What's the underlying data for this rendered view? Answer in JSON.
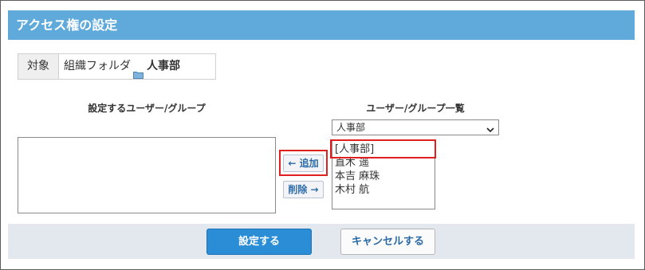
{
  "header": {
    "title": "アクセス権の設定"
  },
  "target": {
    "label": "対象",
    "path_prefix": "組織フォルダ",
    "folder_name": "人事部"
  },
  "left_column": {
    "title": "設定するユーザー/グループ"
  },
  "right_column": {
    "title": "ユーザー/グループ一覧",
    "selected_group": "人事部",
    "items": [
      "[人事部]",
      "直木 遥",
      "本吉 麻珠",
      "木村 航"
    ]
  },
  "buttons": {
    "add": "← 追加",
    "remove": "削除 →",
    "save": "設定する",
    "cancel": "キャンセルする"
  },
  "colors": {
    "header_bg": "#5fa9db",
    "primary_btn": "#2b8dd6",
    "highlight": "#e0201f",
    "footer_bg": "#e3e8ef"
  }
}
